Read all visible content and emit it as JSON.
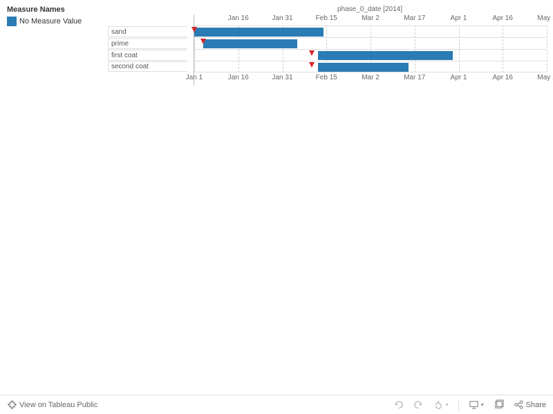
{
  "legend": {
    "title": "Measure Names",
    "item": "No Measure Value",
    "color": "#2b7cb4"
  },
  "axis_title": "phase_0_date [2014]",
  "ticks": [
    "Jan 1",
    "Jan 16",
    "Jan 31",
    "Feb 15",
    "Mar 2",
    "Mar 17",
    "Apr 1",
    "Apr 16",
    "May 1"
  ],
  "chart_data": {
    "type": "bar",
    "orientation": "horizontal-gantt",
    "title": "phase_0_date [2014]",
    "xlabel": "",
    "ylabel": "",
    "xlim": [
      "2014-01-01",
      "2014-05-01"
    ],
    "categories": [
      "sand",
      "prime",
      "first coat",
      "second coat"
    ],
    "series": [
      {
        "name": "sand",
        "start": "2014-01-01",
        "end": "2014-02-14",
        "marker": "2014-01-01"
      },
      {
        "name": "prime",
        "start": "2014-01-04",
        "end": "2014-02-05",
        "marker": "2014-01-04"
      },
      {
        "name": "first coat",
        "start": "2014-02-12",
        "end": "2014-03-30",
        "marker": "2014-02-10"
      },
      {
        "name": "second coat",
        "start": "2014-02-12",
        "end": "2014-03-15",
        "marker": "2014-02-10"
      }
    ],
    "marker_color": "#d62728",
    "bar_color": "#2b7cb4"
  },
  "toolbar": {
    "view_label": "View on Tableau Public",
    "share_label": "Share"
  }
}
